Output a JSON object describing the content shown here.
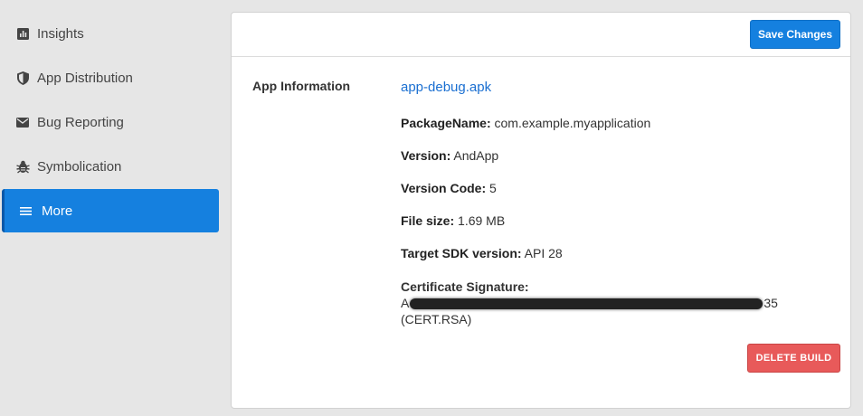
{
  "sidebar": {
    "items": [
      {
        "label": "Insights",
        "icon": "bar-chart-icon"
      },
      {
        "label": "App Distribution",
        "icon": "shield-icon"
      },
      {
        "label": "Bug Reporting",
        "icon": "envelope-icon"
      },
      {
        "label": "Symbolication",
        "icon": "bug-icon"
      },
      {
        "label": "More",
        "icon": "menu-icon",
        "active": true
      }
    ]
  },
  "header": {
    "save_label": "Save Changes"
  },
  "app_info": {
    "section_label": "App Information",
    "file_link": "app-debug.apk",
    "package_label": "PackageName:",
    "package_value": "com.example.myapplication",
    "version_label": "Version:",
    "version_value": "AndApp",
    "version_code_label": "Version Code:",
    "version_code_value": "5",
    "file_size_label": "File size:",
    "file_size_value": "1.69 MB",
    "target_sdk_label": "Target SDK version:",
    "target_sdk_value": "API 28",
    "cert_label": "Certificate Signature:",
    "cert_prefix": "A",
    "cert_suffix": "35",
    "cert_file": "(CERT.RSA)"
  },
  "actions": {
    "delete_label": "DELETE BUILD"
  },
  "colors": {
    "accent": "#1580df",
    "danger": "#e85a5a",
    "link": "#1a6fd1"
  }
}
